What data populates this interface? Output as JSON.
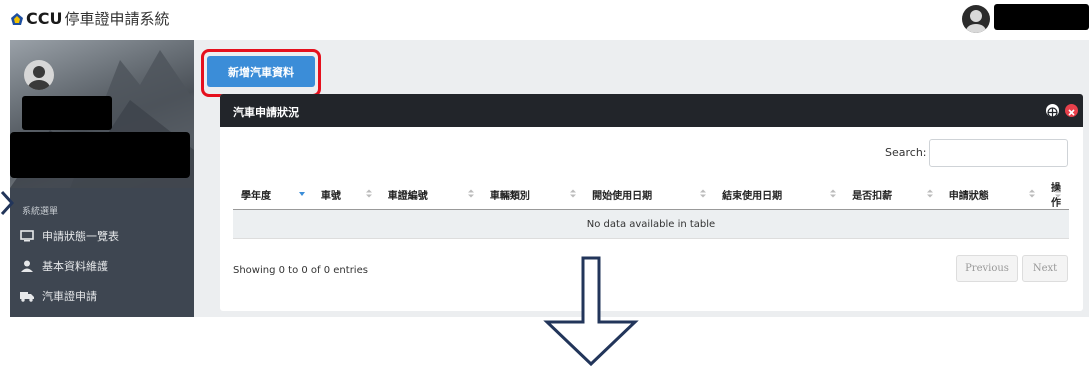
{
  "header": {
    "brand_ccu": "CCU",
    "brand_system": "停車證申請系統"
  },
  "sidebar": {
    "menu_header": "系統選單",
    "items": [
      {
        "label": "申請狀態一覽表",
        "icon": "monitor-icon"
      },
      {
        "label": "基本資料維護",
        "icon": "user-icon"
      },
      {
        "label": "汽車證申請",
        "icon": "car-icon"
      }
    ]
  },
  "toolbar": {
    "add_button_label": "新增汽車資料"
  },
  "panel": {
    "title": "汽車申請狀況",
    "search_label": "Search:",
    "search_value": "",
    "columns": [
      "學年度",
      "車號",
      "車證編號",
      "車輛類別",
      "開始使用日期",
      "結束使用日期",
      "是否扣薪",
      "申請狀態",
      "操作"
    ],
    "empty_message": "No data available in table",
    "info": "Showing 0 to 0 of 0 entries",
    "prev_label": "Previous",
    "next_label": "Next"
  },
  "colors": {
    "accent_button": "#3b8dd8",
    "highlight_outline": "#e5101d",
    "sidebar_bg": "#3e4651",
    "panel_header_bg": "#22252a",
    "arrow": "#22355a"
  }
}
